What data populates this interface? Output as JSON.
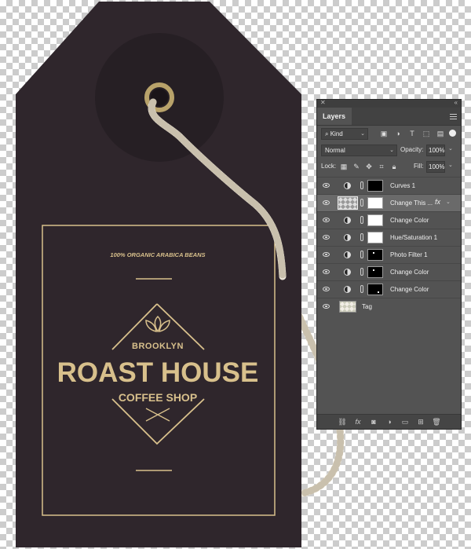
{
  "artwork": {
    "tagline": "100% ORGANIC ARABICA BEANS",
    "location": "BROOKLYN",
    "brand": "ROAST HOUSE",
    "subtitle": "COFFEE SHOP",
    "colors": {
      "tag": "#2f262c",
      "gold": "#d8c08c",
      "rope": "#efe9dc"
    }
  },
  "layers_panel": {
    "tab_label": "Layers",
    "filter_kind": "Kind",
    "blend_mode": "Normal",
    "opacity_label": "Opacity:",
    "opacity_value": "100%",
    "lock_label": "Lock:",
    "fill_label": "Fill:",
    "fill_value": "100%",
    "layers": [
      {
        "name": "Curves 1",
        "type": "adjustment",
        "visible": true
      },
      {
        "name": "Change This ...",
        "type": "smart-object",
        "visible": true,
        "selected": true,
        "fx": "fx"
      },
      {
        "name": "Change Color",
        "type": "adjustment",
        "visible": true
      },
      {
        "name": "Hue/Saturation 1",
        "type": "adjustment",
        "visible": true
      },
      {
        "name": "Photo Filter 1",
        "type": "adjustment",
        "visible": true
      },
      {
        "name": "Change Color",
        "type": "adjustment",
        "visible": true
      },
      {
        "name": "Change Color",
        "type": "adjustment",
        "visible": true
      },
      {
        "name": "Tag",
        "type": "pixel",
        "visible": true
      }
    ],
    "bottom_icons": [
      "link-icon",
      "fx-icon",
      "mask-icon",
      "adjustment-icon",
      "folder-icon",
      "new-layer-icon",
      "trash-icon"
    ]
  }
}
